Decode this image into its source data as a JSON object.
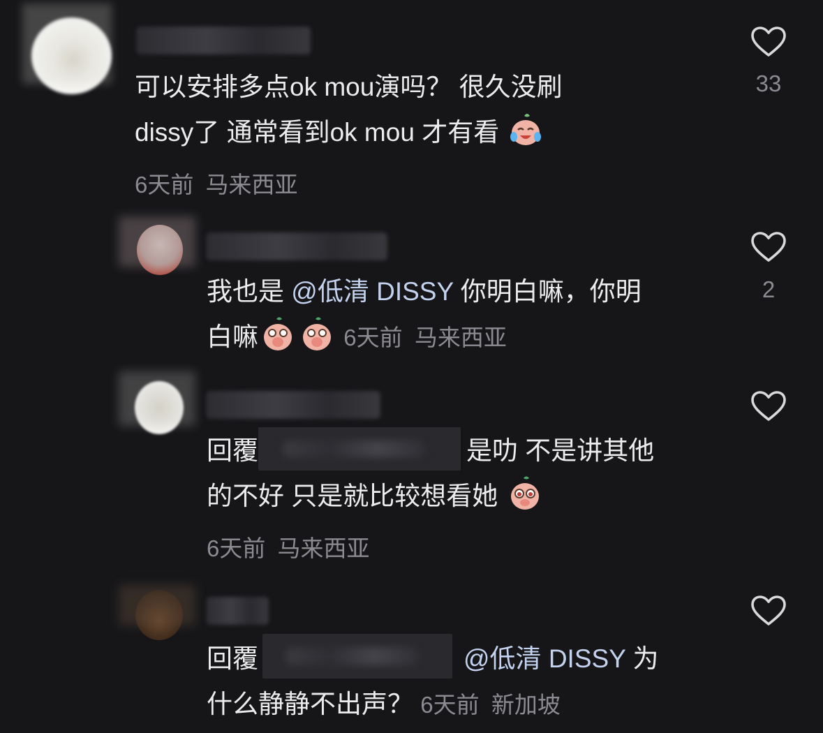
{
  "comments": [
    {
      "text": "可以安排多点ok mou演吗？ 很久没刷dissy了 通常看到ok mou 才有看",
      "line1": "可以安排多点ok mou演吗？ 很久没刷",
      "line2": "dissy了 通常看到ok mou 才有看",
      "time": "6天前",
      "location": "马来西亚",
      "likes": "33",
      "emoji": "crying-laughing-sticker-icon"
    },
    {
      "prefix": "我也是",
      "mention": "@低清 DISSY",
      "suffix1": "你明白嘛，你明",
      "suffix2": "白嘛",
      "time": "6天前",
      "location": "马来西亚",
      "likes": "2",
      "emoji": "covering-mouth-sticker-icon"
    },
    {
      "prefix": "回覆",
      "line1_after": "是叻 不是讲其他",
      "line2": "的不好 只是就比较想看她",
      "time": "6天前",
      "location": "马来西亚",
      "likes": "",
      "emoji": "pleading-sticker-icon"
    },
    {
      "prefix": "回覆",
      "mention": "@低清 DISSY",
      "suffix1": "为",
      "line2": "什么静静不出声？",
      "time": "6天前",
      "location": "新加坡",
      "likes": ""
    }
  ],
  "colors": {
    "background": "#161619",
    "text": "#ececee",
    "meta": "#8b8b91",
    "mention": "#c3d2ee",
    "sticker": "#f2b3a7"
  }
}
